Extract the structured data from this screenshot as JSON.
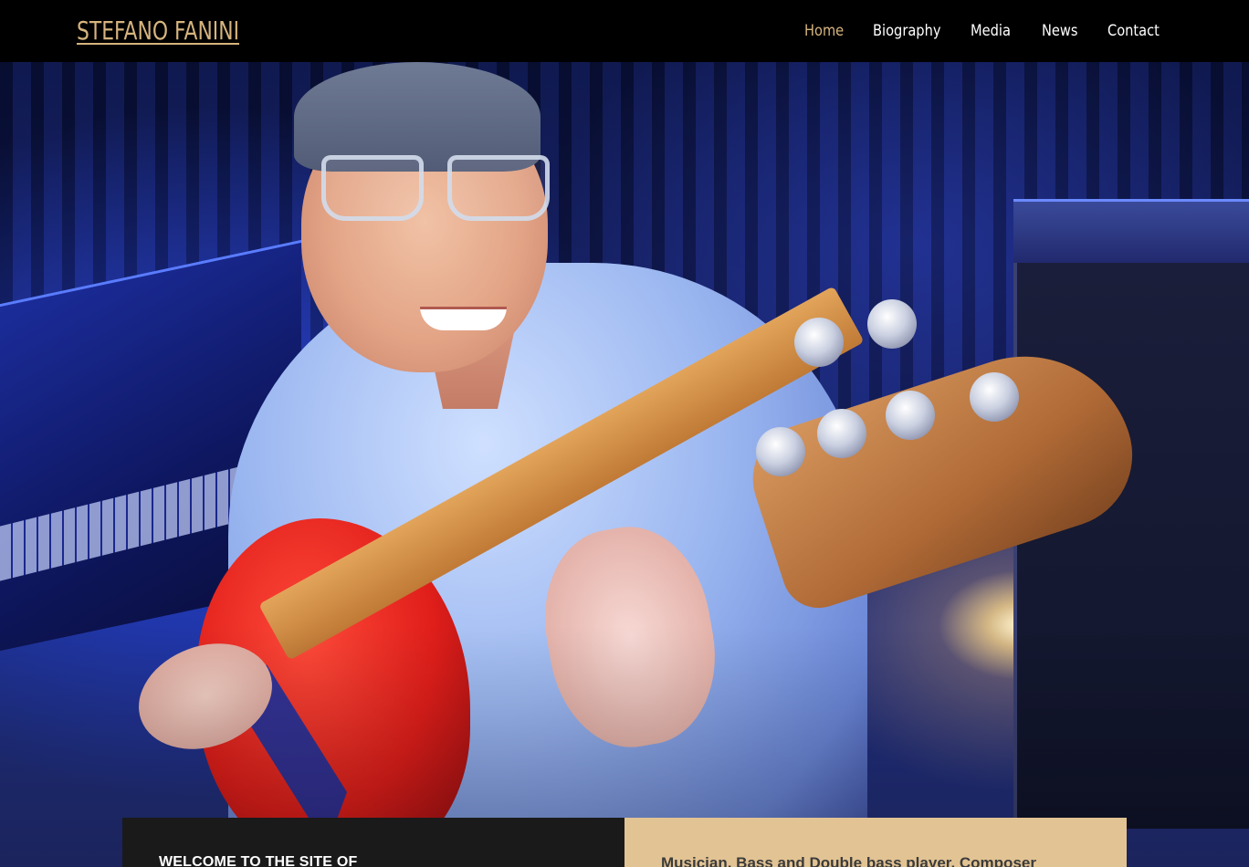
{
  "header": {
    "site_title": "STEFANO FANINI",
    "nav": [
      {
        "label": "Home",
        "active": true
      },
      {
        "label": "Biography",
        "active": false
      },
      {
        "label": "Media",
        "active": false
      },
      {
        "label": "News",
        "active": false
      },
      {
        "label": "Contact",
        "active": false
      }
    ]
  },
  "colors": {
    "accent": "#d6b47e",
    "header_bg": "#000000",
    "panel_dark": "#1a1a1a",
    "panel_light": "#e2c393"
  },
  "hero": {
    "image_subject": "bass-player-portrait"
  },
  "panels": {
    "welcome_text": "WELCOME TO THE SITE OF",
    "tagline_text": "Musician, Bass and Double bass player, Composer"
  }
}
